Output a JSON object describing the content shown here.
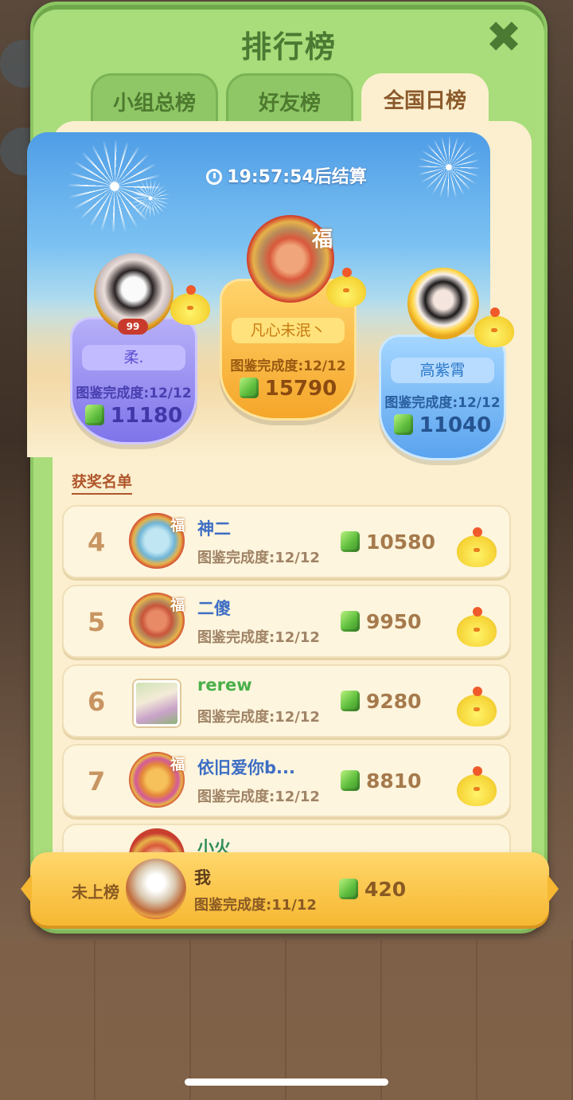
{
  "panel": {
    "title": "排行榜"
  },
  "tabs": [
    {
      "label": "小组总榜",
      "active": false
    },
    {
      "label": "好友榜",
      "active": false
    },
    {
      "label": "全国日榜",
      "active": true
    }
  ],
  "countdown": "19:57:54后结算",
  "top3": [
    {
      "rank": 2,
      "name": "柔.",
      "level_badge": "99",
      "completion": "图鉴完成度:12/12",
      "score": "11180"
    },
    {
      "rank": 1,
      "name": "凡心未泯丶",
      "avatar_text": "福",
      "completion": "图鉴完成度:12/12",
      "score": "15790"
    },
    {
      "rank": 3,
      "name": "高紫霄",
      "completion": "图鉴完成度:12/12",
      "score": "11040"
    }
  ],
  "list_title": "获奖名单",
  "list": [
    {
      "rank": "4",
      "name": "神二",
      "avatar_text": "福",
      "completion": "图鉴完成度:12/12",
      "score": "10580"
    },
    {
      "rank": "5",
      "name": "二傻",
      "avatar_text": "福",
      "completion": "图鉴完成度:12/12",
      "score": "9950"
    },
    {
      "rank": "6",
      "name": "rerew",
      "completion": "图鉴完成度:12/12",
      "score": "9280"
    },
    {
      "rank": "7",
      "name": "依旧爱你b...",
      "avatar_text": "福",
      "completion": "图鉴完成度:12/12",
      "score": "8810"
    },
    {
      "rank": "",
      "name": "小火",
      "completion": "",
      "score": ""
    }
  ],
  "me": {
    "status": "未上榜",
    "name": "我",
    "completion": "图鉴完成度:11/12",
    "score": "420"
  },
  "icons": {
    "close": "close-icon",
    "clock": "clock-icon",
    "score_gem": "green-gem-icon",
    "reward": "chick-reward-icon"
  },
  "colors": {
    "panel": "#a9dc7a",
    "inner": "#fbefcf",
    "first": "#f6b832",
    "second": "#8f86f0",
    "third": "#6aaef0"
  }
}
